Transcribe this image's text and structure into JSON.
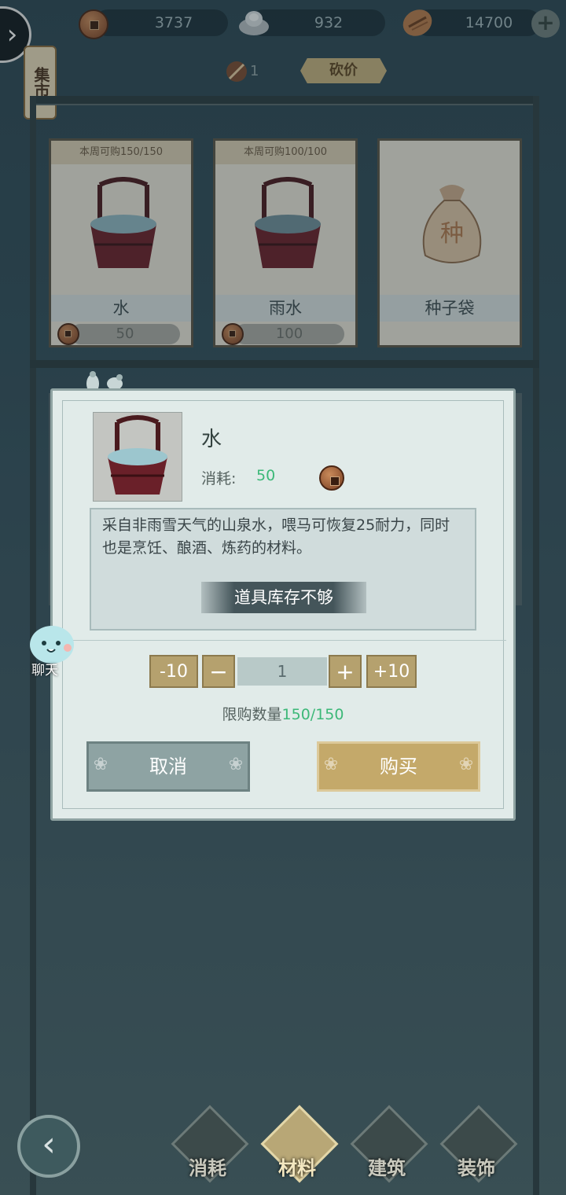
{
  "top_bar": {
    "copper_coins": "3737",
    "silver_ingots": "932",
    "seeds": "14700",
    "add_icon": "plus-icon",
    "expand_icon": "chevron-right-icon"
  },
  "market": {
    "sign": "集市",
    "bargain_count": "1",
    "bargain_label": "砍价"
  },
  "shop_items": [
    {
      "limit": "本周可购150/150",
      "name": "水",
      "price": "50"
    },
    {
      "limit": "本周可购100/100",
      "name": "雨水",
      "price": "100"
    },
    {
      "limit": "",
      "name": "种子袋",
      "price": ""
    }
  ],
  "dialog": {
    "item_name": "水",
    "cost_label": "消耗:",
    "cost_value": "50",
    "description": "采自非雨雪天气的山泉水，喂马可恢复25耐力，同时也是烹饪、酿酒、炼药的材料。",
    "stock_message": "道具库存不够",
    "minus10": "-10",
    "minus": "−",
    "quantity": "1",
    "plus": "+",
    "plus10": "+10",
    "limit_label": "限购数量",
    "limit_value": "150/150",
    "cancel": "取消",
    "buy": "购买"
  },
  "chat_label": "聊天",
  "bottom_tabs": [
    "消耗",
    "材料",
    "建筑",
    "装饰"
  ],
  "colors": {
    "accent_green": "#3cb878",
    "gold_button": "#c4a96a",
    "gray_button": "#8ea3a3"
  }
}
